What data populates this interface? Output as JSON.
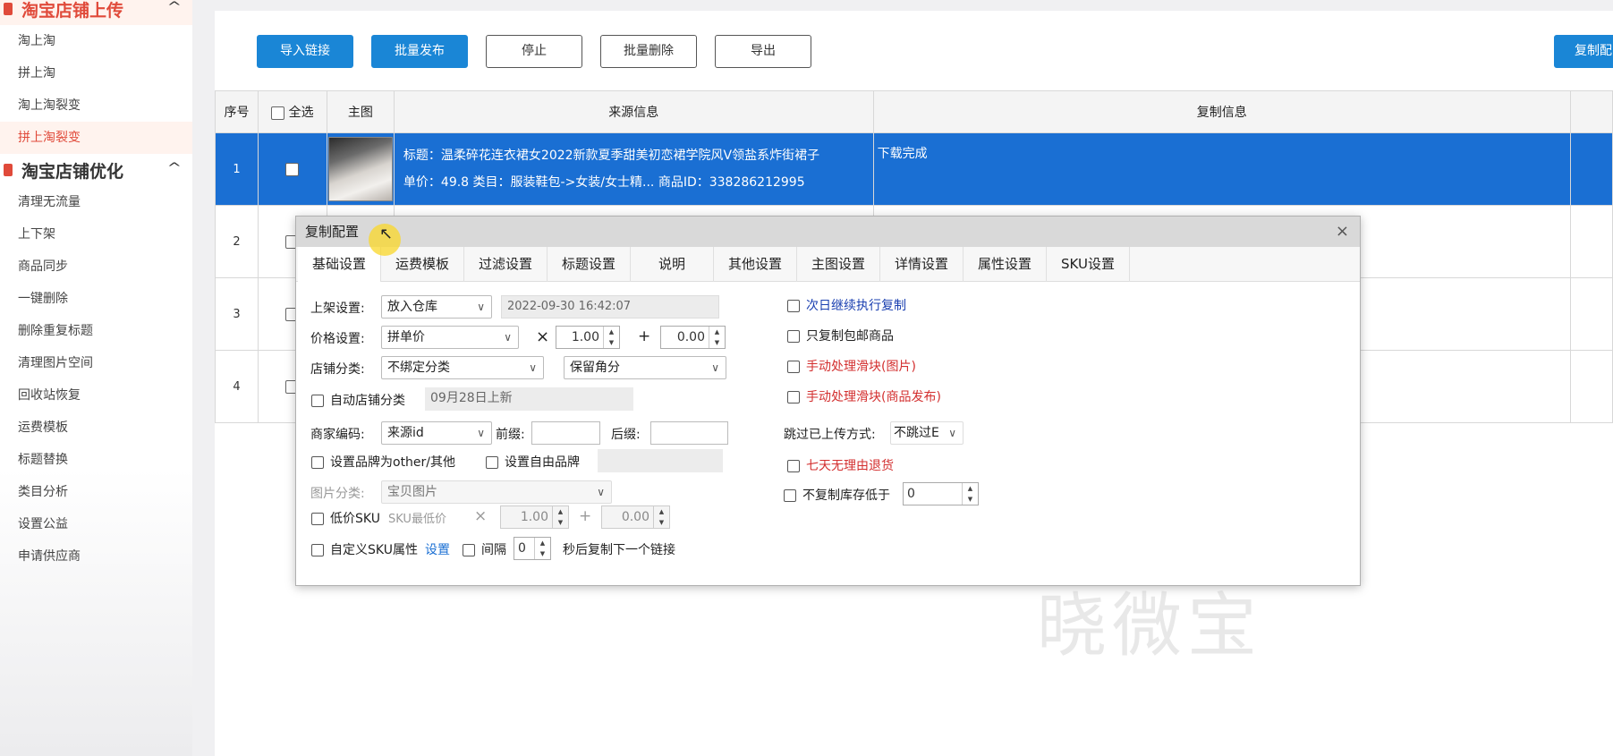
{
  "sidebar": {
    "group1": {
      "title": "淘宝店铺上传",
      "items": [
        "淘上淘",
        "拼上淘",
        "淘上淘裂变",
        "拼上淘裂变"
      ]
    },
    "group2": {
      "title": "淘宝店铺优化",
      "items": [
        "清理无流量",
        "上下架",
        "商品同步",
        "一键删除",
        "删除重复标题",
        "清理图片空间",
        "回收站恢复",
        "运费模板",
        "标题替换",
        "类目分析",
        "设置公益",
        "申请供应商"
      ]
    }
  },
  "toolbar": {
    "import_link": "导入链接",
    "batch_publish": "批量发布",
    "stop": "停止",
    "batch_delete": "批量删除",
    "export": "导出",
    "copy_config": "复制配"
  },
  "table": {
    "headers": {
      "index": "序号",
      "select_all": "全选",
      "main_image": "主图",
      "source": "来源信息",
      "copy_info": "复制信息"
    },
    "rows": [
      {
        "index": "1",
        "title": "标题：温柔碎花连衣裙女2022新款夏季甜美初恋裙学院风V领盐系炸街裙子",
        "detail": "单价：49.8  类目：服装鞋包->女装/女士精...  商品ID：338286212995",
        "copy_info": "下载完成"
      },
      {
        "index": "2"
      },
      {
        "index": "3"
      },
      {
        "index": "4"
      }
    ]
  },
  "dialog": {
    "title": "复制配置",
    "close": "×",
    "tabs": [
      "基础设置",
      "运费模板",
      "过滤设置",
      "标题设置",
      "说明",
      "其他设置",
      "主图设置",
      "详情设置",
      "属性设置",
      "SKU设置"
    ],
    "listing": {
      "label": "上架设置:",
      "value": "放入仓库",
      "datetime": "2022-09-30 16:42:07"
    },
    "price": {
      "label": "价格设置:",
      "value": "拼单价",
      "times": "×",
      "multiplier": "1.00",
      "plus": "+",
      "addend": "0.00"
    },
    "store_category": {
      "label": "店铺分类:",
      "value": "不绑定分类",
      "round": "保留角分"
    },
    "auto_category": {
      "label": "自动店铺分类",
      "value": "09月28日上新"
    },
    "merchant_code": {
      "label": "商家编码:",
      "value": "来源id",
      "prefix_label": "前缀:",
      "suffix_label": "后缀:"
    },
    "brand_other": "设置品牌为other/其他",
    "brand_free": "设置自由品牌",
    "image_category": {
      "label": "图片分类:",
      "value": "宝贝图片"
    },
    "low_sku": {
      "label": "低价SKU",
      "min_label": "SKU最低价",
      "times": "×",
      "multiplier": "1.00",
      "plus": "+",
      "addend": "0.00"
    },
    "custom_sku": {
      "label": "自定义SKU属性",
      "link": "设置",
      "interval_label": "间隔",
      "interval": "0",
      "suffix": "秒后复制下一个链接"
    },
    "right": {
      "continue_next_day": "次日继续执行复制",
      "only_free_shipping": "只复制包邮商品",
      "manual_slider_image": "手动处理滑块(图片)",
      "manual_slider_publish": "手动处理滑块(商品发布)",
      "skip_label": "跳过已上传方式:",
      "skip_value": "不跳过E",
      "seven_day_return": "七天无理由退货",
      "min_stock_label": "不复制库存低于",
      "min_stock_value": "0"
    },
    "watermark": "晓微宝"
  },
  "colors": {
    "accent_blue": "#1a86d6",
    "selected_row": "#1a6fd3",
    "brand_red": "#e04a3a"
  }
}
